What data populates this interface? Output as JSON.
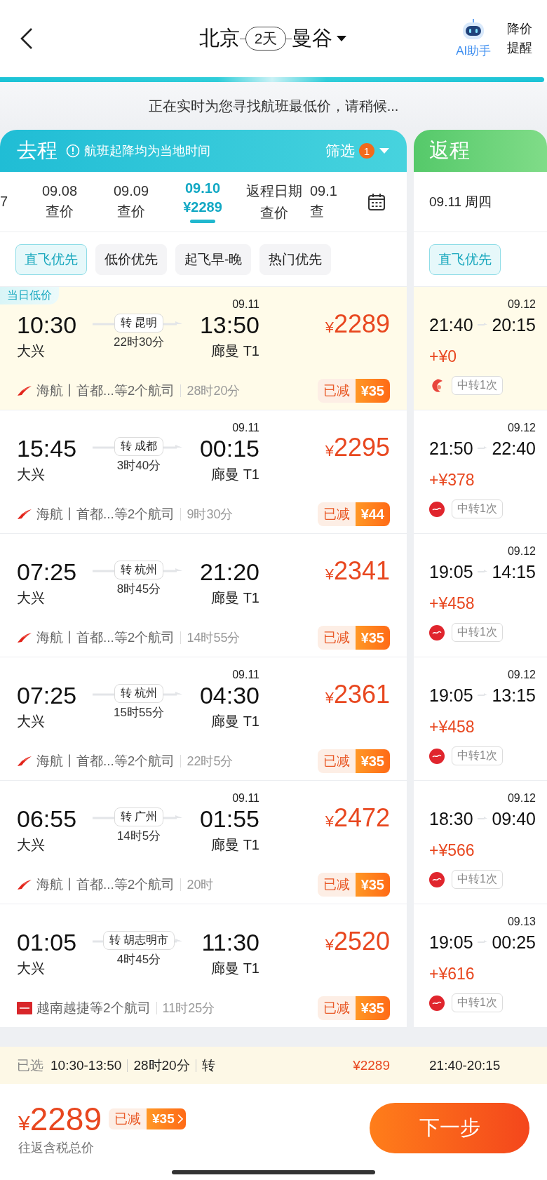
{
  "header": {
    "origin": "北京",
    "days": "2天",
    "destination": "曼谷",
    "assistant": "AI助手",
    "price_alert": "降价提醒"
  },
  "progress": {
    "level": 1
  },
  "status": "正在实时为您寻找航班最低价，请稍候...",
  "outbound": {
    "title": "去程",
    "note": "航班起降均为当地时间",
    "filter": "筛选",
    "filter_count": "1",
    "dates": [
      {
        "date": "7",
        "selected": false
      },
      {
        "date": "09.08",
        "sub": "查价",
        "selected": false
      },
      {
        "date": "09.09",
        "sub": "查价",
        "selected": false
      },
      {
        "date": "09.10",
        "sub": "¥2289",
        "selected": true
      },
      {
        "date": "返程日期",
        "sub": "查价",
        "selected": false
      },
      {
        "date": "09.1",
        "sub": "查",
        "selected": false
      }
    ],
    "sorts": [
      {
        "label": "直飞优先",
        "selected": true
      },
      {
        "label": "低价优先",
        "selected": false
      },
      {
        "label": "起飞早-晚",
        "selected": false
      },
      {
        "label": "热门优先",
        "selected": false
      }
    ],
    "flights": [
      {
        "badge": "当日低价",
        "highlighted": true,
        "dep_time": "10:30",
        "dep_airport": "大兴",
        "via": "转 昆明",
        "layover": "22时30分",
        "arr_date": "09.11",
        "arr_time": "13:50",
        "arr_airport": "廊曼 T1",
        "currency": "¥",
        "price": "2289",
        "kind": "swoosh",
        "airline": "海航丨首都...等2个航司",
        "duration": "28时20分",
        "discount_label": "已减",
        "discount": "¥35"
      },
      {
        "highlighted": false,
        "dep_time": "15:45",
        "dep_airport": "大兴",
        "via": "转 成都",
        "layover": "3时40分",
        "arr_date": "09.11",
        "arr_time": "00:15",
        "arr_airport": "廊曼 T1",
        "currency": "¥",
        "price": "2295",
        "kind": "swoosh",
        "airline": "海航丨首都...等2个航司",
        "duration": "9时30分",
        "discount_label": "已减",
        "discount": "¥44"
      },
      {
        "highlighted": false,
        "dep_time": "07:25",
        "dep_airport": "大兴",
        "via": "转 杭州",
        "layover": "8时45分",
        "arr_time": "21:20",
        "arr_airport": "廊曼 T1",
        "currency": "¥",
        "price": "2341",
        "kind": "swoosh",
        "airline": "海航丨首都...等2个航司",
        "duration": "14时55分",
        "discount_label": "已减",
        "discount": "¥35"
      },
      {
        "highlighted": false,
        "dep_time": "07:25",
        "dep_airport": "大兴",
        "via": "转 杭州",
        "layover": "15时55分",
        "arr_date": "09.11",
        "arr_time": "04:30",
        "arr_airport": "廊曼 T1",
        "currency": "¥",
        "price": "2361",
        "kind": "swoosh",
        "airline": "海航丨首都...等2个航司",
        "duration": "22时5分",
        "discount_label": "已减",
        "discount": "¥35"
      },
      {
        "highlighted": false,
        "dep_time": "06:55",
        "dep_airport": "大兴",
        "via": "转 广州",
        "layover": "14时5分",
        "arr_date": "09.11",
        "arr_time": "01:55",
        "arr_airport": "廊曼 T1",
        "currency": "¥",
        "price": "2472",
        "kind": "swoosh",
        "airline": "海航丨首都...等2个航司",
        "duration": "20时",
        "discount_label": "已减",
        "discount": "¥35"
      },
      {
        "highlighted": false,
        "dep_time": "01:05",
        "dep_airport": "大兴",
        "via": "转 胡志明市",
        "layover": "4时45分",
        "arr_time": "11:30",
        "arr_airport": "廊曼 T1",
        "currency": "¥",
        "price": "2520",
        "kind": "square",
        "airline": "越南越捷等2个航司",
        "duration": "11时25分",
        "discount_label": "已减",
        "discount": "¥35"
      }
    ]
  },
  "return": {
    "title": "返程",
    "date": "09.11 周四",
    "sorts": [
      {
        "label": "直飞优先",
        "selected": true
      }
    ],
    "flights": [
      {
        "highlighted": true,
        "date": "09.12",
        "dep_time": "21:40",
        "arr_time": "20:15",
        "extra": "+¥0",
        "kind": "bird",
        "stops": "中转1次"
      },
      {
        "highlighted": false,
        "date": "09.12",
        "dep_time": "21:50",
        "arr_time": "22:40",
        "extra": "+¥378",
        "kind": "circle",
        "stops": "中转1次"
      },
      {
        "highlighted": false,
        "date": "09.12",
        "dep_time": "19:05",
        "arr_time": "14:15",
        "extra": "+¥458",
        "kind": "circle",
        "stops": "中转1次"
      },
      {
        "highlighted": false,
        "date": "09.12",
        "dep_time": "19:05",
        "arr_time": "13:15",
        "extra": "+¥458",
        "kind": "circle",
        "stops": "中转1次"
      },
      {
        "highlighted": false,
        "date": "09.12",
        "dep_time": "18:30",
        "arr_time": "09:40",
        "extra": "+¥566",
        "kind": "circle",
        "stops": "中转1次"
      },
      {
        "highlighted": false,
        "date": "09.13",
        "dep_time": "19:05",
        "arr_time": "00:25",
        "extra": "+¥616",
        "kind": "circle",
        "stops": "中转1次"
      }
    ]
  },
  "selection": {
    "label": "已选",
    "times": "10:30-13:50",
    "duration": "28时20分",
    "transfer": "转",
    "price": "¥2289",
    "return_times": "21:40-20:15"
  },
  "total": {
    "currency": "¥",
    "amount": "2289",
    "discount_label": "已减",
    "discount": "¥35",
    "note": "往返含税总价"
  },
  "next_button": "下一步"
}
